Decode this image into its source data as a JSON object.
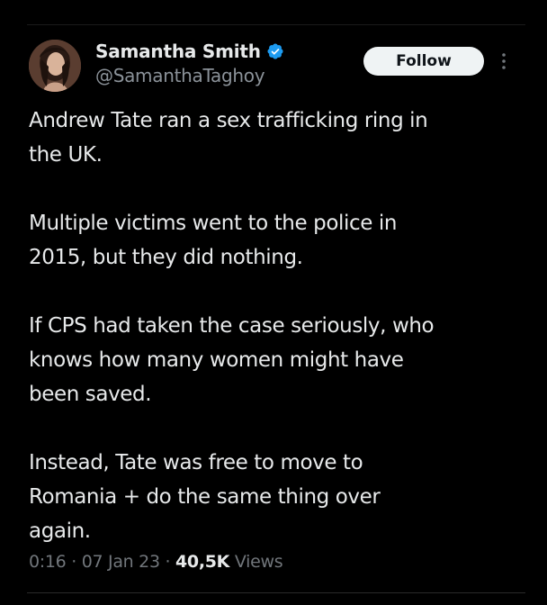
{
  "author": {
    "display_name": "Samantha Smith",
    "handle": "@SamanthaTaghoy",
    "verified": true,
    "avatar_icon": "profile-photo"
  },
  "actions": {
    "follow_label": "Follow",
    "more_icon": "more-vertical-icon"
  },
  "tweet": {
    "paragraphs": [
      "Andrew Tate ran a sex trafficking ring in\nthe UK.",
      "Multiple victims went to the police in\n2015, but they did nothing.",
      "If CPS had taken the case seriously, who\nknows how many women might have\nbeen saved.",
      "Instead, Tate was free to move to\nRomania + do the same thing over\nagain."
    ]
  },
  "meta": {
    "time": "0:16",
    "separator": "·",
    "date": "07 Jan 23",
    "views_count": "40,5K",
    "views_label": "Views"
  },
  "colors": {
    "background": "#000000",
    "text_primary": "#e7e9ea",
    "text_secondary": "#71767b",
    "verified_blue": "#1d9bf0",
    "follow_bg": "#eff3f4"
  }
}
